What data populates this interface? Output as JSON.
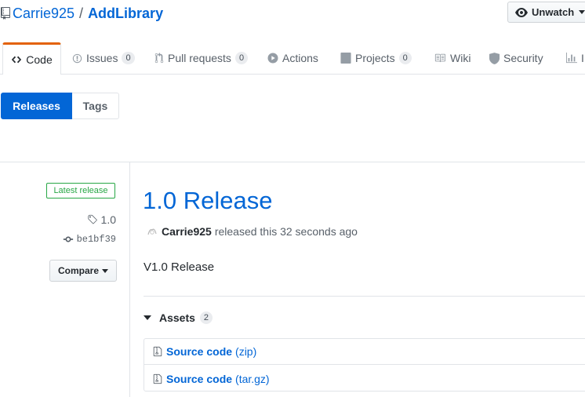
{
  "repo": {
    "owner": "Carrie925",
    "separator": "/",
    "name": "AddLibrary",
    "watch_label": "Unwatch"
  },
  "tabs": [
    {
      "label": "Code",
      "icon": "code-icon",
      "selected": true
    },
    {
      "label": "Issues",
      "icon": "issue-icon",
      "count": "0"
    },
    {
      "label": "Pull requests",
      "icon": "pull-request-icon",
      "count": "0"
    },
    {
      "label": "Actions",
      "icon": "play-icon"
    },
    {
      "label": "Projects",
      "icon": "project-icon",
      "count": "0"
    },
    {
      "label": "Wiki",
      "icon": "book-icon"
    },
    {
      "label": "Security",
      "icon": "shield-icon"
    },
    {
      "label": "I",
      "icon": "graph-icon"
    }
  ],
  "subnav": {
    "releases_label": "Releases",
    "tags_label": "Tags"
  },
  "release": {
    "latest_badge": "Latest release",
    "tag": "1.0",
    "commit": "be1bf39",
    "compare_label": "Compare",
    "title": "1.0 Release",
    "author": "Carrie925",
    "released_text": "released this 32 seconds ago",
    "body": "V1.0 Release"
  },
  "assets": {
    "heading": "Assets",
    "count": "2",
    "items": [
      {
        "name": "Source code",
        "ext": "(zip)"
      },
      {
        "name": "Source code",
        "ext": "(tar.gz)"
      }
    ]
  },
  "colors": {
    "link": "#0366d6",
    "accent_tab": "#e36209",
    "latest_green": "#28a745",
    "text": "#24292e",
    "muted": "#586069",
    "border": "#e1e4e8"
  }
}
